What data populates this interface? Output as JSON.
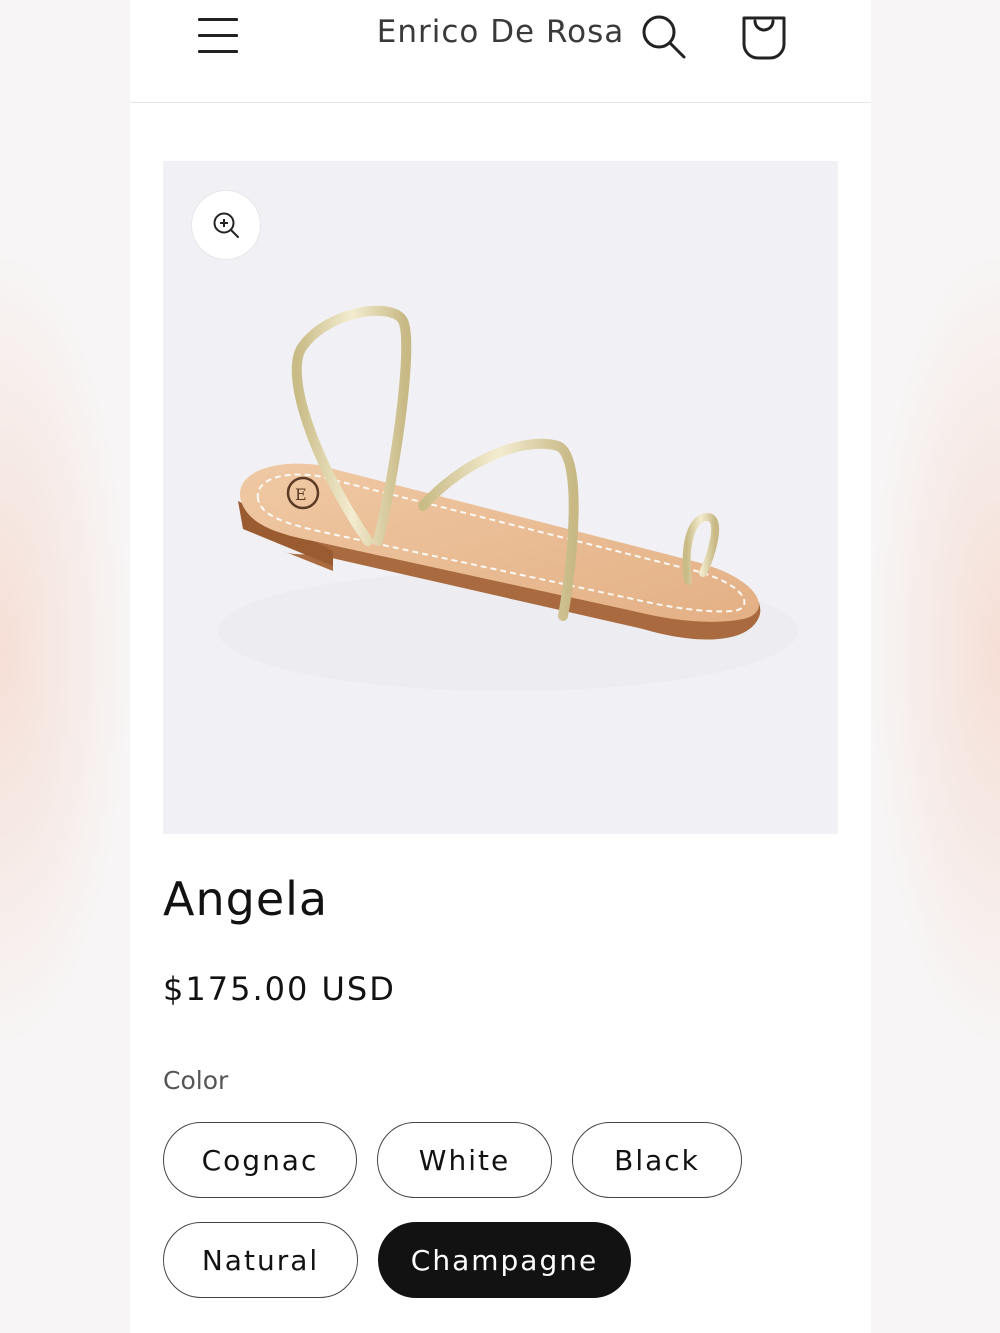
{
  "header": {
    "brand": "Enrico De Rosa",
    "menu_icon": "hamburger-menu-icon",
    "search_icon": "search-icon",
    "cart_icon": "shopping-bag-icon"
  },
  "product": {
    "title": "Angela",
    "price": "$175.00 USD",
    "image_alt_description": "",
    "zoom_icon": "zoom-in-icon"
  },
  "variants": {
    "label": "Color",
    "options": [
      {
        "label": "Cognac",
        "selected": false
      },
      {
        "label": "White",
        "selected": false
      },
      {
        "label": "Black",
        "selected": false
      },
      {
        "label": "Natural",
        "selected": false
      },
      {
        "label": "Champagne",
        "selected": true
      }
    ]
  },
  "colors": {
    "accent": "#121212",
    "background": "#ffffff",
    "media_background": "#f1f1f5",
    "sole": "#e9b98e",
    "strap": "#e2d7a9"
  }
}
